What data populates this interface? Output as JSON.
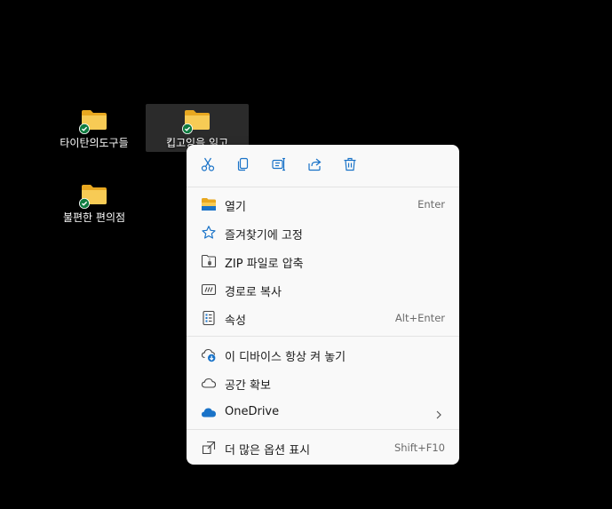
{
  "desktop": {
    "icons": [
      {
        "label": "타이탄의도구들"
      },
      {
        "label": "킵고잉을 읽고"
      },
      {
        "label": "불편한 편의점"
      }
    ]
  },
  "context_menu": {
    "toolbar": [
      {
        "icon": "cut-icon"
      },
      {
        "icon": "copy-icon"
      },
      {
        "icon": "rename-icon"
      },
      {
        "icon": "share-icon"
      },
      {
        "icon": "delete-icon"
      }
    ],
    "items": [
      {
        "label": "열기",
        "shortcut": "Enter",
        "icon": "folder-open-icon"
      },
      {
        "label": "즐겨찾기에 고정",
        "shortcut": "",
        "icon": "star-icon"
      },
      {
        "label": "ZIP 파일로 압축",
        "shortcut": "",
        "icon": "zip-icon"
      },
      {
        "label": "경로로 복사",
        "shortcut": "",
        "icon": "copy-path-icon"
      },
      {
        "label": "속성",
        "shortcut": "Alt+Enter",
        "icon": "properties-icon"
      },
      {
        "label": "이 디바이스 항상 켜 놓기",
        "shortcut": "",
        "icon": "cloud-download-icon"
      },
      {
        "label": "공간 확보",
        "shortcut": "",
        "icon": "cloud-icon"
      },
      {
        "label": "OneDrive",
        "shortcut": "",
        "icon": "onedrive-icon"
      },
      {
        "label": "더 많은 옵션 표시",
        "shortcut": "Shift+F10",
        "icon": "more-options-icon"
      }
    ]
  },
  "colors": {
    "accent": "#1a73c8",
    "folder": "#f5c542",
    "sync_check": "#107c41"
  }
}
